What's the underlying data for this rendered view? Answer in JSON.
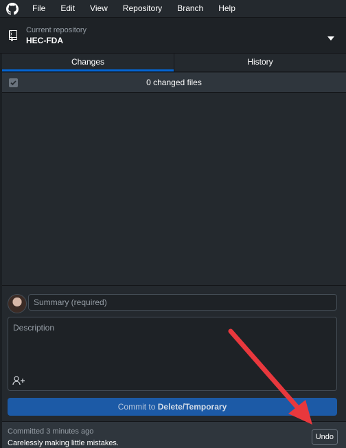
{
  "menubar": {
    "items": [
      "File",
      "Edit",
      "View",
      "Repository",
      "Branch",
      "Help"
    ]
  },
  "repository": {
    "label": "Current repository",
    "name": "HEC-FDA"
  },
  "tabs": [
    {
      "label": "Changes",
      "selected": true
    },
    {
      "label": "History",
      "selected": false
    }
  ],
  "changes": {
    "count_text": "0 changed files"
  },
  "commit": {
    "summary_placeholder": "Summary (required)",
    "description_placeholder": "Description",
    "button_prefix": "Commit to ",
    "button_branch": "Delete/Temporary"
  },
  "last_commit": {
    "when": "Committed 3 minutes ago",
    "message": "Carelessly making little mistakes.",
    "undo_label": "Undo"
  },
  "colors": {
    "accent": "#0366d6",
    "commit_button": "#1c5aa6",
    "annotation_arrow": "#e8383d"
  }
}
